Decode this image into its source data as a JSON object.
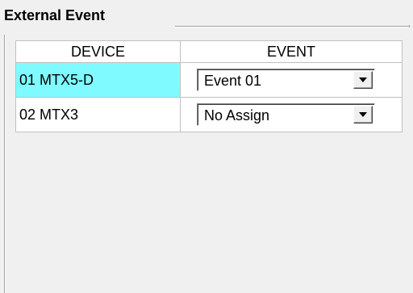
{
  "panel": {
    "title": "External Event"
  },
  "table": {
    "headers": {
      "device": "DEVICE",
      "event": "EVENT"
    },
    "rows": [
      {
        "device": "01 MTX5-D",
        "event": "Event 01",
        "selected": true
      },
      {
        "device": "02 MTX3",
        "event": "No Assign",
        "selected": false
      }
    ]
  },
  "colors": {
    "selected_row": "#7ffbff",
    "panel_bg": "#f0f0f0"
  },
  "icons": {
    "dropdown_arrow": "chevron-down-icon"
  }
}
